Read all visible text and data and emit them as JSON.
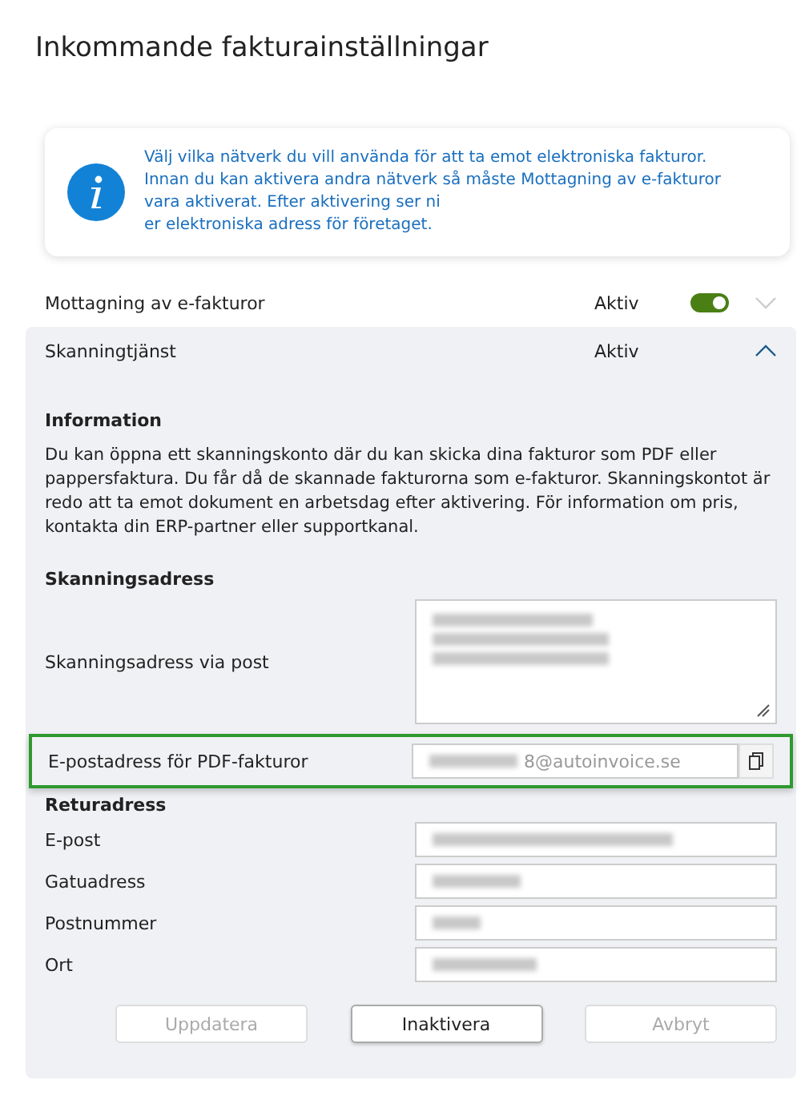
{
  "title": "Inkommande fakturainställningar",
  "info": {
    "lines": [
      "Välj vilka nätverk du vill använda för att ta emot elektroniska fakturor.",
      "Innan du kan aktivera andra nätverk så måste Mottagning av e-fakturor",
      "vara aktiverat. Efter aktivering ser ni",
      "er elektroniska adress för företaget."
    ]
  },
  "services": [
    {
      "name": "Mottagning av e-fakturor",
      "status": "Aktiv",
      "on": true,
      "expanded": false
    },
    {
      "name": "Skanningtjänst",
      "status": "Aktiv",
      "expanded": true
    }
  ],
  "panel": {
    "info_heading": "Information",
    "info_text": "Du kan öppna ett skanningskonto där du kan skicka dina fakturor som PDF eller pappersfaktura. Du får då de skannade fakturorna som e-fakturor. Skanningskontot är redo att ta emot dokument en arbetsdag efter aktivering. För information om pris, kontakta din ERP-partner eller supportkanal.",
    "scan_heading": "Skanningsadress",
    "fields": [
      {
        "kind": "textarea",
        "label": "Skanningsadress via post",
        "redacted": true,
        "highlighted": false
      },
      {
        "kind": "copy",
        "label": "E-postadress för PDF-fakturor",
        "value": "8@autoinvoice.se",
        "redacted": true,
        "highlighted": true
      }
    ],
    "return_heading": "Returadress",
    "return_fields": [
      {
        "label": "E-post",
        "redacted": true
      },
      {
        "label": "Gatuadress",
        "redacted": true
      },
      {
        "label": "Postnummer",
        "redacted": true
      },
      {
        "label": "Ort",
        "redacted": true
      }
    ],
    "buttons": [
      {
        "label": "Uppdatera",
        "disabled": true
      },
      {
        "label": "Inaktivera",
        "disabled": false
      },
      {
        "label": "Avbryt",
        "disabled": true
      }
    ]
  }
}
